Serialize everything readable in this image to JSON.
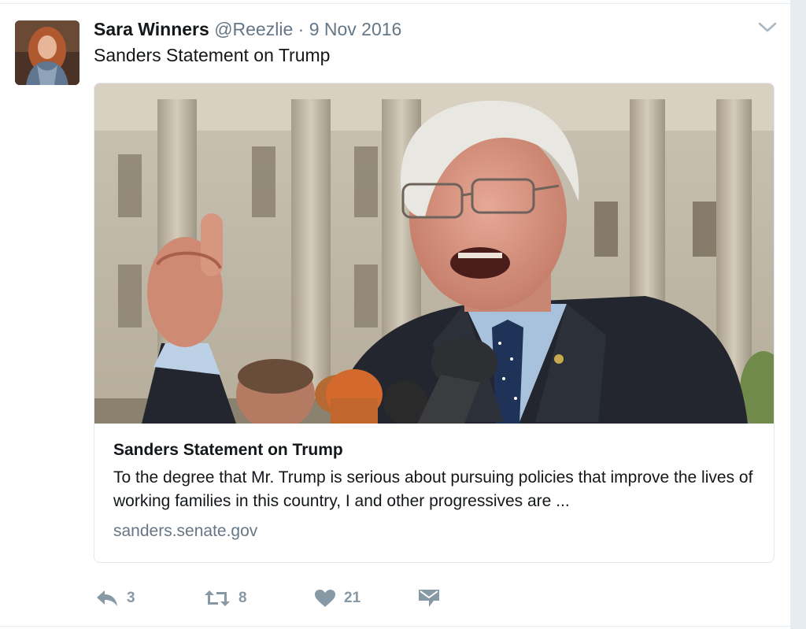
{
  "tweet": {
    "author_name": "Sara Winners",
    "username": "@Reezlie",
    "separator": "·",
    "timestamp": "9 Nov 2016",
    "text": "Sanders Statement on Trump",
    "avatar_icon": "user-avatar-photo"
  },
  "card": {
    "image_desc_icon": "card-photo",
    "title": "Sanders Statement on Trump",
    "description": "To the degree that Mr. Trump is serious about pursuing policies that improve the lives of working families in this country, I and other progressives are ...",
    "domain": "sanders.senate.gov"
  },
  "actions": {
    "reply": {
      "icon": "reply-icon",
      "count": "3"
    },
    "retweet": {
      "icon": "retweet-icon",
      "count": "8"
    },
    "like": {
      "icon": "heart-icon",
      "count": "21"
    },
    "message": {
      "icon": "direct-message-icon"
    }
  },
  "colors": {
    "text": "#14171a",
    "secondary": "#657786",
    "action_icon": "#8899a6",
    "border": "#e1e8ed"
  }
}
